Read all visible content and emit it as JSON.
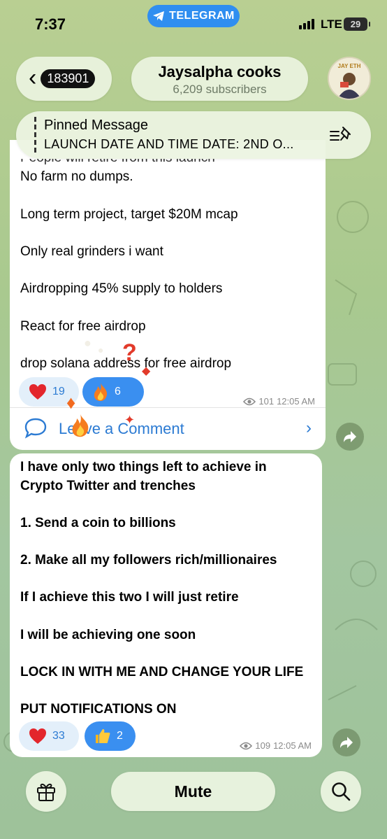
{
  "status_bar": {
    "time": "7:37",
    "app_pill": "TELEGRAM",
    "network": "LTE",
    "battery": "29"
  },
  "header": {
    "back_count": "183901",
    "channel_title": "Jaysalpha cooks",
    "subscribers": "6,209 subscribers",
    "avatar_text": "JAY ETH"
  },
  "pinned": {
    "title": "Pinned Message",
    "text": "LAUNCH DATE AND TIME DATE: 2ND O..."
  },
  "messages": [
    {
      "partial_line": "People will retire from this launch",
      "lines": [
        "No farm no dumps.",
        "Long term project, target $20M mcap",
        "Only real grinders i want",
        "Airdropping 45% supply to holders",
        "React  for free airdrop",
        "drop solana address for free airdrop"
      ],
      "reactions": [
        {
          "emoji": "heart",
          "count": "19"
        },
        {
          "emoji": "fire",
          "count": "6"
        }
      ],
      "views": "101",
      "time": "12:05 AM",
      "comment_label": "Leave a Comment"
    },
    {
      "lines": [
        "I have only two things left to achieve in",
        "Crypto Twitter and trenches",
        "1. Send a coin to billions",
        "2. Make all my followers rich/millionaires",
        "If I achieve this two I will just retire",
        "I will be achieving one soon",
        "LOCK IN WITH ME AND CHANGE YOUR LIFE",
        "PUT NOTIFICATIONS ON"
      ],
      "reactions": [
        {
          "emoji": "heart",
          "count": "33"
        },
        {
          "emoji": "thumbs-up",
          "count": "2"
        }
      ],
      "views": "109",
      "time": "12:05 AM"
    }
  ],
  "bottom_bar": {
    "mute_label": "Mute"
  },
  "colors": {
    "accent": "#2c7bd3",
    "active_reaction": "#3a8ff0",
    "telegram_pill": "#2f8ef0"
  }
}
